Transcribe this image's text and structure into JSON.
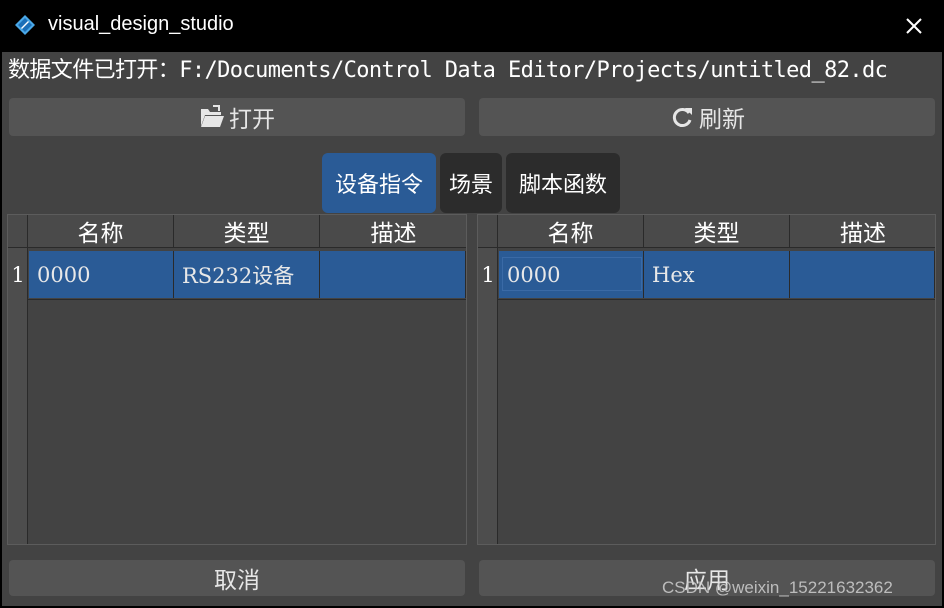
{
  "window": {
    "title": "visual_design_studio",
    "icon": "pencil-diamond-icon",
    "close_icon": "close-icon"
  },
  "file_status": "数据文件已打开：F:/Documents/Control Data Editor/Projects/untitled_82.dc",
  "toolbar": {
    "open_label": "打开",
    "open_icon": "folder-open-icon",
    "refresh_label": "刷新",
    "refresh_icon": "refresh-icon"
  },
  "tabs": [
    {
      "label": "设备指令",
      "active": true
    },
    {
      "label": "场景",
      "active": false
    },
    {
      "label": "脚本函数",
      "active": false
    }
  ],
  "left_table": {
    "columns": [
      "名称",
      "类型",
      "描述"
    ],
    "rows": [
      {
        "num": "1",
        "cells": [
          "0000",
          "RS232设备",
          ""
        ]
      }
    ]
  },
  "right_table": {
    "columns": [
      "名称",
      "类型",
      "描述"
    ],
    "rows": [
      {
        "num": "1",
        "cells": [
          "0000",
          "Hex",
          ""
        ]
      }
    ]
  },
  "footer": {
    "cancel_label": "取消",
    "apply_label": "应用"
  },
  "watermark": "CSDN @weixin_15221632362",
  "colors": {
    "accent": "#2a5b96",
    "background": "#434343",
    "button": "#545454",
    "titlebar": "#000000"
  }
}
